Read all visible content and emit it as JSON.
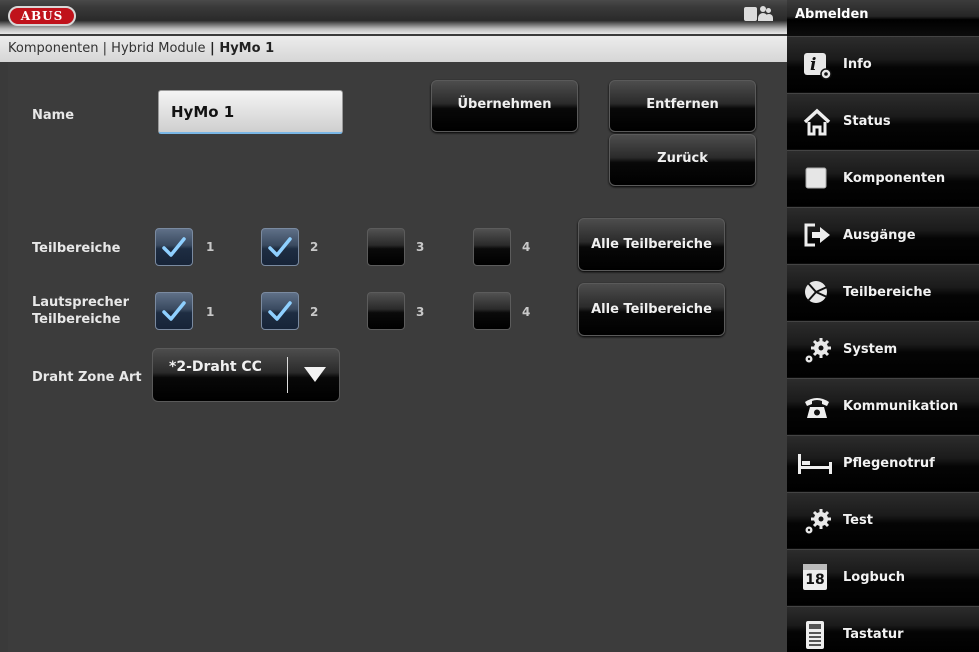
{
  "header": {
    "logo_text": "ABUS",
    "logout_label": "Abmelden",
    "user_icon": "users-icon"
  },
  "breadcrumb": {
    "part1": "Komponenten",
    "sep1": " | ",
    "part2": "Hybrid Module",
    "sep2": " | ",
    "current": "HyMo 1"
  },
  "form": {
    "name_label": "Name",
    "name_value": "HyMo 1",
    "apply_button": "Übernehmen",
    "remove_button": "Entfernen",
    "back_button": "Zurück",
    "partitions_label": "Teilbereiche",
    "partitions": [
      {
        "num": "1",
        "checked": true
      },
      {
        "num": "2",
        "checked": true
      },
      {
        "num": "3",
        "checked": false
      },
      {
        "num": "4",
        "checked": false
      }
    ],
    "partitions_all_button": "Alle Teilbereiche",
    "speaker_label_line1": "Lautsprecher",
    "speaker_label_line2": "Teilbereiche",
    "speaker_partitions": [
      {
        "num": "1",
        "checked": true
      },
      {
        "num": "2",
        "checked": true
      },
      {
        "num": "3",
        "checked": false
      },
      {
        "num": "4",
        "checked": false
      }
    ],
    "speaker_all_button": "Alle Teilbereiche",
    "wire_zone_label": "Draht Zone Art",
    "wire_zone_value": "*2-Draht CC"
  },
  "sidebar": {
    "items": [
      {
        "label": "Info",
        "icon": "info-icon"
      },
      {
        "label": "Status",
        "icon": "home-icon"
      },
      {
        "label": "Komponenten",
        "icon": "square-icon"
      },
      {
        "label": "Ausgänge",
        "icon": "exit-arrow-icon"
      },
      {
        "label": "Teilbereiche",
        "icon": "pie-icon"
      },
      {
        "label": "System",
        "icon": "gears-icon"
      },
      {
        "label": "Kommunikation",
        "icon": "telephone-icon"
      },
      {
        "label": "Pflegenotruf",
        "icon": "bed-icon"
      },
      {
        "label": "Test",
        "icon": "gears-icon"
      },
      {
        "label": "Logbuch",
        "icon": "calendar-icon"
      },
      {
        "label": "Tastatur",
        "icon": "keypad-icon"
      }
    ],
    "calendar_day": "18"
  }
}
